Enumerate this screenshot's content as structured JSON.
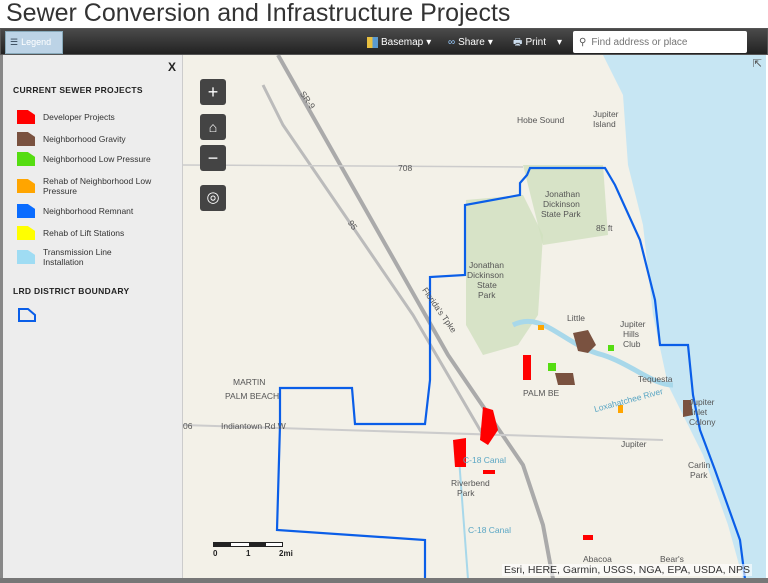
{
  "title": "Sewer Conversion and Infrastructure Projects",
  "toolbar": {
    "legend": "Legend",
    "basemap": "Basemap",
    "share": "Share",
    "print": "Print",
    "search_placeholder": "Find address or place"
  },
  "legend": {
    "close": "X",
    "section1": "CURRENT SEWER PROJECTS",
    "items": [
      {
        "label": "Developer Projects",
        "color": "#ff0000"
      },
      {
        "label": "Neighborhood Gravity",
        "color": "#7a5240"
      },
      {
        "label": "Neighborhood Low Pressure",
        "color": "#55dd11"
      },
      {
        "label": "Rehab of Neighborhood Low Pressure",
        "color": "#ffa500"
      },
      {
        "label": "Neighborhood Remnant",
        "color": "#0a6cff"
      },
      {
        "label": "Rehab of Lift Stations",
        "color": "#ffff00"
      },
      {
        "label": "Transmission Line Installation",
        "color": "#9fdcf3"
      }
    ],
    "section2": "LRD DISTRICT BOUNDARY",
    "boundary_color": "#0a5ee8"
  },
  "map": {
    "labels": {
      "hobe": "Hobe Sound",
      "jisland1": "Jupiter",
      "jisland2": "Island",
      "jdsp1a": "Jonathan",
      "jdsp1b": "Dickinson",
      "jdsp1c": "State Park",
      "jdsp2a": "Jonathan",
      "jdsp2b": "Dickinson",
      "jdsp2c": "State",
      "jdsp2d": "Park",
      "little": "Little",
      "jhc1": "Jupiter",
      "jhc2": "Hills",
      "jhc3": "Club",
      "tequesta": "Tequesta",
      "jic1": "Jupiter",
      "jic2": "Inlet",
      "jic3": "Colony",
      "jupiter": "Jupiter",
      "carlin1": "Carlin",
      "carlin2": "Park",
      "river1": "Riverbend",
      "river2": "Park",
      "abacoa": "Abacoa",
      "bears": "Bear's",
      "martin": "MARTIN",
      "palmbeach": "PALM BEACH",
      "palm2": "PALM BE",
      "indiantown": "Indiantown Rd W",
      "r708": "708",
      "r706": "06",
      "sr9": "SR-9",
      "i95": "95",
      "tpke": "Florida's Tpke",
      "lox": "Loxahatchee River",
      "c18": "C-18 Canal",
      "c18b": "C-18 Canal",
      "ft85": "85 ft"
    },
    "scale": {
      "s0": "0",
      "s1": "1",
      "s2": "2mi"
    },
    "attribution": "Esri, HERE, Garmin, USGS, NGA, EPA, USDA, NPS"
  }
}
